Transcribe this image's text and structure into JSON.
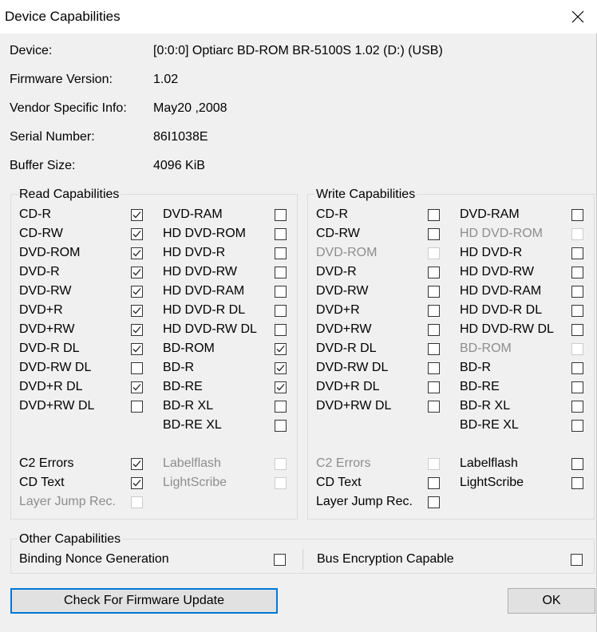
{
  "window": {
    "title": "Device Capabilities"
  },
  "info": {
    "device_label": "Device:",
    "device_value": "[0:0:0] Optiarc BD-ROM BR-5100S 1.02 (D:) (USB)",
    "firmware_label": "Firmware Version:",
    "firmware_value": "1.02",
    "vendor_label": "Vendor Specific Info:",
    "vendor_value": "May20 ,2008",
    "serial_label": "Serial Number:",
    "serial_value": "86I1038E",
    "buffer_label": "Buffer Size:",
    "buffer_value": "4096 KiB"
  },
  "read": {
    "title": "Read Capabilities",
    "items": [
      {
        "label": "CD-R",
        "checked": true,
        "enabled": true
      },
      {
        "label": "CD-RW",
        "checked": true,
        "enabled": true
      },
      {
        "label": "DVD-ROM",
        "checked": true,
        "enabled": true
      },
      {
        "label": "DVD-R",
        "checked": true,
        "enabled": true
      },
      {
        "label": "DVD-RW",
        "checked": true,
        "enabled": true
      },
      {
        "label": "DVD+R",
        "checked": true,
        "enabled": true
      },
      {
        "label": "DVD+RW",
        "checked": true,
        "enabled": true
      },
      {
        "label": "DVD-R DL",
        "checked": true,
        "enabled": true
      },
      {
        "label": "DVD-RW DL",
        "checked": false,
        "enabled": true
      },
      {
        "label": "DVD+R DL",
        "checked": true,
        "enabled": true
      },
      {
        "label": "DVD+RW DL",
        "checked": false,
        "enabled": true
      },
      {
        "label": "DVD-RAM",
        "checked": false,
        "enabled": true
      },
      {
        "label": "HD DVD-ROM",
        "checked": false,
        "enabled": true
      },
      {
        "label": "HD DVD-R",
        "checked": false,
        "enabled": true
      },
      {
        "label": "HD DVD-RW",
        "checked": false,
        "enabled": true
      },
      {
        "label": "HD DVD-RAM",
        "checked": false,
        "enabled": true
      },
      {
        "label": "HD DVD-R DL",
        "checked": false,
        "enabled": true
      },
      {
        "label": "HD DVD-RW DL",
        "checked": false,
        "enabled": true
      },
      {
        "label": "BD-ROM",
        "checked": true,
        "enabled": true
      },
      {
        "label": "BD-R",
        "checked": true,
        "enabled": true
      },
      {
        "label": "BD-RE",
        "checked": true,
        "enabled": true
      },
      {
        "label": "BD-R XL",
        "checked": false,
        "enabled": true
      },
      {
        "label": "BD-RE XL",
        "checked": false,
        "enabled": true
      },
      {
        "label": "C2 Errors",
        "checked": true,
        "enabled": true
      },
      {
        "label": "CD Text",
        "checked": true,
        "enabled": true
      },
      {
        "label": "Layer Jump Rec.",
        "checked": false,
        "enabled": false
      },
      {
        "label": "Labelflash",
        "checked": false,
        "enabled": false
      },
      {
        "label": "LightScribe",
        "checked": false,
        "enabled": false
      }
    ]
  },
  "write": {
    "title": "Write Capabilities",
    "items": [
      {
        "label": "CD-R",
        "checked": false,
        "enabled": true
      },
      {
        "label": "CD-RW",
        "checked": false,
        "enabled": true
      },
      {
        "label": "DVD-ROM",
        "checked": false,
        "enabled": false
      },
      {
        "label": "DVD-R",
        "checked": false,
        "enabled": true
      },
      {
        "label": "DVD-RW",
        "checked": false,
        "enabled": true
      },
      {
        "label": "DVD+R",
        "checked": false,
        "enabled": true
      },
      {
        "label": "DVD+RW",
        "checked": false,
        "enabled": true
      },
      {
        "label": "DVD-R DL",
        "checked": false,
        "enabled": true
      },
      {
        "label": "DVD-RW DL",
        "checked": false,
        "enabled": true
      },
      {
        "label": "DVD+R DL",
        "checked": false,
        "enabled": true
      },
      {
        "label": "DVD+RW DL",
        "checked": false,
        "enabled": true
      },
      {
        "label": "DVD-RAM",
        "checked": false,
        "enabled": true
      },
      {
        "label": "HD DVD-ROM",
        "checked": false,
        "enabled": false
      },
      {
        "label": "HD DVD-R",
        "checked": false,
        "enabled": true
      },
      {
        "label": "HD DVD-RW",
        "checked": false,
        "enabled": true
      },
      {
        "label": "HD DVD-RAM",
        "checked": false,
        "enabled": true
      },
      {
        "label": "HD DVD-R DL",
        "checked": false,
        "enabled": true
      },
      {
        "label": "HD DVD-RW DL",
        "checked": false,
        "enabled": true
      },
      {
        "label": "BD-ROM",
        "checked": false,
        "enabled": false
      },
      {
        "label": "BD-R",
        "checked": false,
        "enabled": true
      },
      {
        "label": "BD-RE",
        "checked": false,
        "enabled": true
      },
      {
        "label": "BD-R XL",
        "checked": false,
        "enabled": true
      },
      {
        "label": "BD-RE XL",
        "checked": false,
        "enabled": true
      },
      {
        "label": "C2 Errors",
        "checked": false,
        "enabled": false
      },
      {
        "label": "CD Text",
        "checked": false,
        "enabled": true
      },
      {
        "label": "Layer Jump Rec.",
        "checked": false,
        "enabled": true
      },
      {
        "label": "Labelflash",
        "checked": false,
        "enabled": true
      },
      {
        "label": "LightScribe",
        "checked": false,
        "enabled": true
      }
    ]
  },
  "other": {
    "title": "Other Capabilities",
    "items": [
      {
        "label": "Binding Nonce Generation",
        "checked": false,
        "enabled": true
      },
      {
        "label": "Bus Encryption Capable",
        "checked": false,
        "enabled": true
      }
    ]
  },
  "buttons": {
    "firmware_update": "Check For Firmware Update",
    "ok": "OK"
  },
  "icons": {
    "close": "close-icon",
    "check": "checkmark-icon"
  },
  "colors": {
    "accent": "#0078d7",
    "window_bg": "#f0f0f0",
    "disabled_text": "#8d8d8d"
  }
}
